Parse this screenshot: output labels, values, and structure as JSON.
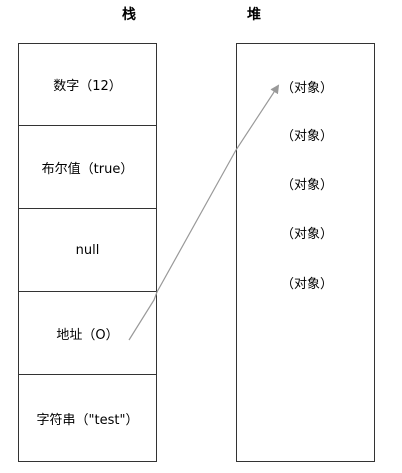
{
  "headings": {
    "stack": "栈",
    "heap": "堆"
  },
  "stack": {
    "items": [
      {
        "label": "数字（12）"
      },
      {
        "label": "布尔值（true）"
      },
      {
        "label": "null"
      },
      {
        "label": "地址（O）"
      },
      {
        "label": "字符串（\"test\"）"
      }
    ]
  },
  "heap": {
    "items": [
      {
        "label": "（对象）"
      },
      {
        "label": "（对象）"
      },
      {
        "label": "（对象）"
      },
      {
        "label": "（对象）"
      },
      {
        "label": "（对象）"
      }
    ]
  },
  "colors": {
    "border": "#333333",
    "arrow": "#999999",
    "text": "#000000"
  }
}
